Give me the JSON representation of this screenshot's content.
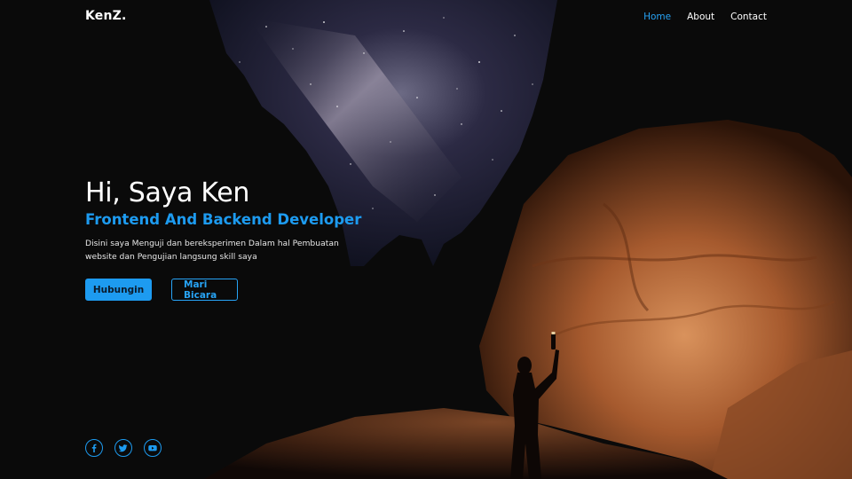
{
  "brand": {
    "logo": "KenZ."
  },
  "nav": {
    "items": [
      {
        "label": "Home",
        "active": true
      },
      {
        "label": "About",
        "active": false
      },
      {
        "label": "Contact",
        "active": false
      }
    ]
  },
  "hero": {
    "greeting": "Hi, Saya Ken",
    "role": "Frontend And Backend Developer",
    "description": "Disini saya Menguji dan bereksperimen Dalam hal Pembuatan website dan Pengujian langsung skill saya",
    "primary_button": "Hubungin",
    "secondary_button": "Mari Bicara"
  },
  "socials": [
    {
      "icon": "facebook-icon"
    },
    {
      "icon": "twitter-icon"
    },
    {
      "icon": "youtube-icon"
    }
  ],
  "colors": {
    "accent": "#1d9bf0",
    "background": "#0b0b0b",
    "rock": "#b8693a"
  }
}
